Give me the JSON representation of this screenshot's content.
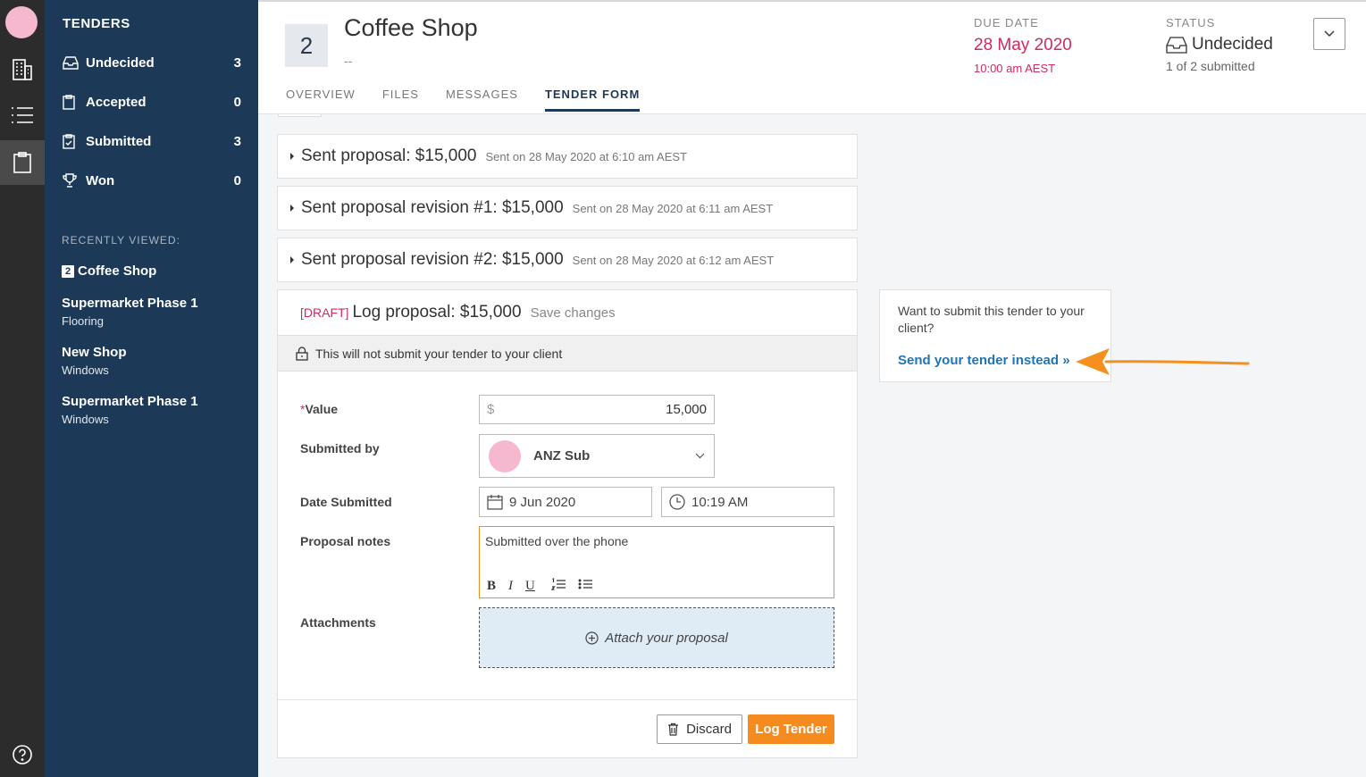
{
  "rail": {
    "icons": [
      "user-avatar",
      "building-icon",
      "list-icon",
      "clipboard-icon",
      "help-icon"
    ]
  },
  "sidebar": {
    "title": "TENDERS",
    "items": [
      {
        "icon": "inbox-icon",
        "label": "Undecided",
        "count": "3"
      },
      {
        "icon": "clipboard-icon",
        "label": "Accepted",
        "count": "0"
      },
      {
        "icon": "clipboard-check-icon",
        "label": "Submitted",
        "count": "3"
      },
      {
        "icon": "trophy-icon",
        "label": "Won",
        "count": "0"
      }
    ],
    "recent_heading": "RECENTLY VIEWED:",
    "recent": [
      {
        "badge": "2",
        "name": "Coffee Shop",
        "sub": ""
      },
      {
        "name": "Supermarket Phase 1",
        "sub": "Flooring"
      },
      {
        "name": "New Shop",
        "sub": "Windows"
      },
      {
        "name": "Supermarket Phase 1",
        "sub": "Windows"
      }
    ]
  },
  "header": {
    "number": "2",
    "title": "Coffee Shop",
    "subtitle": "--",
    "tabs": [
      "OVERVIEW",
      "FILES",
      "MESSAGES",
      "TENDER FORM"
    ],
    "active_tab": "TENDER FORM",
    "due_label": "DUE DATE",
    "due_date": "28 May 2020",
    "due_time": "10:00 am AEST",
    "status_label": "STATUS",
    "status_value": "Undecided",
    "status_sub": "1 of 2 submitted"
  },
  "proposals": [
    {
      "title": "Sent proposal: $15,000",
      "meta": "Sent on 28 May 2020 at 6:10 am AEST"
    },
    {
      "title": "Sent proposal revision #1: $15,000",
      "meta": "Sent on 28 May 2020 at 6:11 am AEST"
    },
    {
      "title": "Sent proposal revision #2: $15,000",
      "meta": "Sent on 28 May 2020 at 6:12 am AEST"
    }
  ],
  "draft": {
    "tag": "[DRAFT]",
    "title": "Log proposal: $15,000",
    "save_label": "Save changes",
    "warning": "This will not submit your tender to your client",
    "fields": {
      "value_label": "Value",
      "value_required": "*",
      "value_currency": "$",
      "value": "15,000",
      "submitted_by_label": "Submitted by",
      "submitted_by": "ANZ Sub",
      "date_label": "Date Submitted",
      "date": "9 Jun 2020",
      "time": "10:19 AM",
      "notes_label": "Proposal notes",
      "notes": "Submitted over the phone",
      "attachments_label": "Attachments",
      "attach_prompt": "Attach your proposal"
    },
    "discard_label": "Discard",
    "log_label": "Log Tender"
  },
  "side_panel": {
    "question": "Want to submit this tender to your client?",
    "link": "Send your tender instead »"
  },
  "colors": {
    "sidebar": "#1c3a57",
    "rail": "#2c2c2c",
    "accent_pink": "#d02a5e",
    "accent_orange": "#f58a1f",
    "link_blue": "#1f76b5"
  }
}
